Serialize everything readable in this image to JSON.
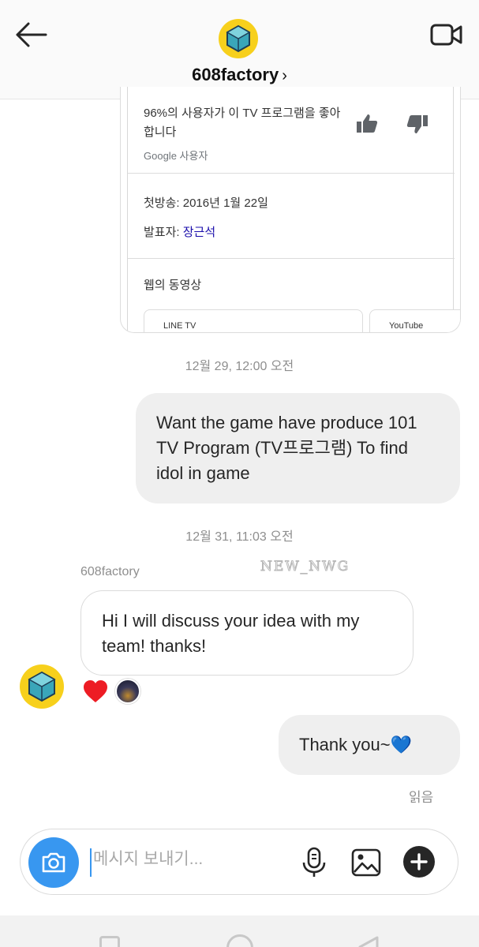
{
  "header": {
    "title": "608factory",
    "title_chevron": "›",
    "back_icon": "arrow-left-icon",
    "video_icon": "video-call-icon",
    "avatar_icon": "608-logo-icon"
  },
  "shared_card": {
    "like_text": "96%의 사용자가 이 TV 프로그램을 좋아합니다",
    "like_source": "Google 사용자",
    "premiere_label": "첫방송: ",
    "premiere_value": "2016년 1월 22일",
    "presenter_label": "발표자: ",
    "presenter_value": "장근석",
    "web_videos_title": "웹의 동영상",
    "video_sources": [
      "LINE TV",
      "YouTube"
    ],
    "link_color": "#1a0dab"
  },
  "messages": {
    "timestamp_1": "12월 29, 12:00 오전",
    "outgoing_1": "Want the game have produce 101 TV Program (TV프로그램) To find idol in game",
    "timestamp_2": "12월 31, 11:03 오전",
    "sender_name": "608factory",
    "watermark": "NEW_NWG",
    "incoming_1": "Hi I will discuss your idea with my team! thanks!",
    "reactions": [
      "heart-icon",
      "user-avatar"
    ],
    "outgoing_2": "Thank you~💙",
    "read_status": "읽음"
  },
  "composer": {
    "placeholder": "메시지 보내기...",
    "camera_icon": "camera-icon",
    "mic_icon": "microphone-icon",
    "gallery_icon": "image-icon",
    "plus_icon": "plus-icon",
    "accent_color": "#3897f0"
  },
  "colors": {
    "outgoing_bubble": "#efefef",
    "secondary_text": "#8e8e8e",
    "heart": "#ed1c24"
  }
}
